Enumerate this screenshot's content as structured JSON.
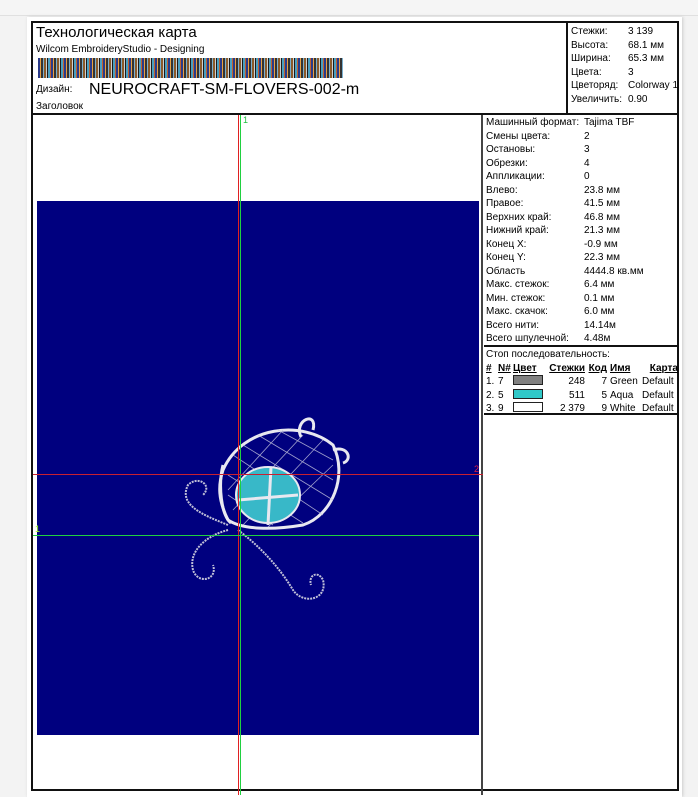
{
  "header": {
    "title": "Технологическая карта",
    "subtitle": "Wilcom EmbroideryStudio - Designing",
    "design_label": "Дизайн:",
    "design_name": "NEUROCRAFT-SM-FLOVERS-002-m",
    "heading_label": "Заголовок"
  },
  "info": [
    {
      "k": "Стежки:",
      "v": "3 139"
    },
    {
      "k": "Высота:",
      "v": "68.1 мм"
    },
    {
      "k": "Ширина:",
      "v": "65.3 мм"
    },
    {
      "k": "Цвета:",
      "v": "3"
    },
    {
      "k": "Цветоряд:",
      "v": "Colorway 1"
    },
    {
      "k": "Увеличить:",
      "v": "0.90"
    }
  ],
  "stats": [
    {
      "k": "Машинный формат:",
      "v": "Tajima TBF"
    },
    {
      "k": "Смены цвета:",
      "v": "2"
    },
    {
      "k": "Остановы:",
      "v": "3"
    },
    {
      "k": "Обрезки:",
      "v": "4"
    },
    {
      "k": "Аппликации:",
      "v": "0"
    },
    {
      "k": "Влево:",
      "v": "23.8 мм"
    },
    {
      "k": "Правое:",
      "v": "41.5 мм"
    },
    {
      "k": "Верхних край:",
      "v": "46.8 мм"
    },
    {
      "k": "Нижний край:",
      "v": "21.3 мм"
    },
    {
      "k": "Конец X:",
      "v": "-0.9 мм"
    },
    {
      "k": "Конец Y:",
      "v": "22.3 мм"
    },
    {
      "k": "Область",
      "v": "4444.8 кв.мм"
    },
    {
      "k": "Макс. стежок:",
      "v": "6.4 мм"
    },
    {
      "k": "Мин. стежок:",
      "v": "0.1 мм"
    },
    {
      "k": "Макс. скачок:",
      "v": "6.0 мм"
    },
    {
      "k": "Всего нити:",
      "v": "14.14м"
    },
    {
      "k": "Всего шпулечной:",
      "v": "4.48м"
    }
  ],
  "sequence": {
    "title": "Стоп последовательность:",
    "headers": [
      "#",
      "N#",
      "Цвет",
      "Стежки",
      "Код",
      "Имя",
      "Карта"
    ],
    "rows": [
      {
        "n": "1.",
        "num": "7",
        "color": "#808080",
        "stitches": "248",
        "code": "7",
        "name": "Green",
        "chart": "Default"
      },
      {
        "n": "2.",
        "num": "5",
        "color": "#30c8c8",
        "stitches": "511",
        "code": "5",
        "name": "Aqua",
        "chart": "Default"
      },
      {
        "n": "3.",
        "num": "9",
        "color": "#ffffff",
        "stitches": "2 379",
        "code": "9",
        "name": "White",
        "chart": "Default"
      }
    ]
  },
  "markers": {
    "top": "1",
    "right": "2",
    "left": "1"
  },
  "colors": {
    "hoop": "#00007f"
  }
}
